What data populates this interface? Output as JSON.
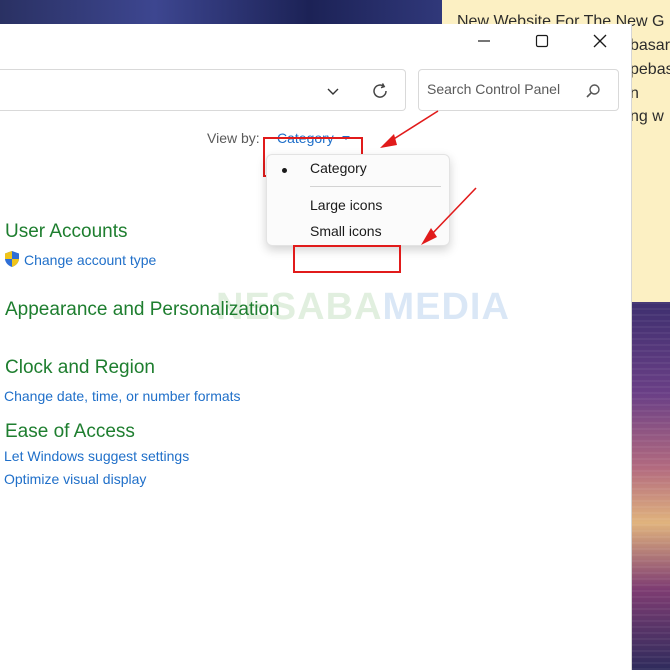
{
  "background": {
    "note_lines": [
      "New Website For The New G",
      "basar",
      "pebas",
      "n",
      "ng w"
    ]
  },
  "titlebar": {
    "minimize_icon": "minimize-icon",
    "maximize_icon": "maximize-icon",
    "close_icon": "close-icon"
  },
  "address_bar": {
    "dropdown_icon": "chevron-down-icon",
    "refresh_icon": "refresh-icon"
  },
  "search": {
    "placeholder": "Search Control Panel",
    "icon": "search-icon"
  },
  "view_by": {
    "label": "View by:",
    "selected": "Category",
    "options": [
      "Category",
      "Large icons",
      "Small icons"
    ]
  },
  "categories": [
    {
      "title": "User Accounts",
      "links": [
        "Change account type"
      ]
    },
    {
      "title": "Appearance and Personalization",
      "links": []
    },
    {
      "title": "Clock and Region",
      "links": [
        "Change date, time, or number formats"
      ]
    },
    {
      "title": "Ease of Access",
      "links": [
        "Let Windows suggest settings",
        "Optimize visual display"
      ]
    }
  ],
  "watermark": {
    "part1": "NESABA",
    "part2": "MEDIA"
  },
  "colors": {
    "category_green": "#1e7e2f",
    "link_blue": "#1f6fc9",
    "annotation_red": "#e11b1b",
    "note_yellow": "#fcf0c3"
  }
}
